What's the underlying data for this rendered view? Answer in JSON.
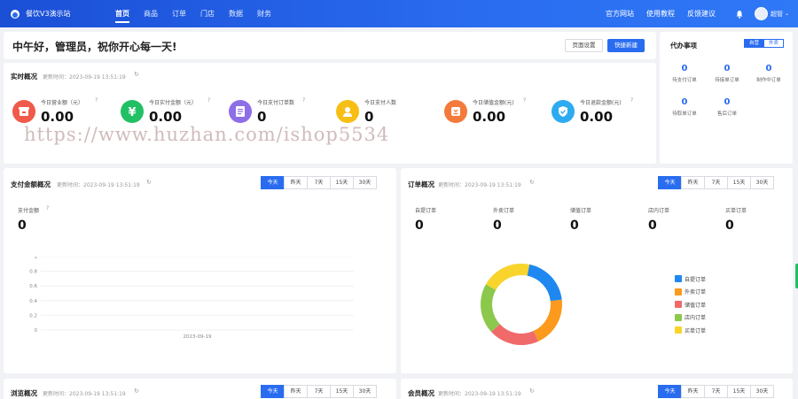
{
  "app": {
    "title": "餐饮V3演示站"
  },
  "nav": [
    {
      "label": "首页",
      "active": true
    },
    {
      "label": "商品",
      "active": false
    },
    {
      "label": "订单",
      "active": false
    },
    {
      "label": "门店",
      "active": false
    },
    {
      "label": "数据",
      "active": false
    },
    {
      "label": "财务",
      "active": false
    }
  ],
  "header_links": [
    "官方网站",
    "使用教程",
    "反馈建议"
  ],
  "user": {
    "name": "超管"
  },
  "greeting": {
    "text": "中午好，管理员，祝你开心每一天!",
    "settings_button": "页面设置",
    "quick_button": "快捷新建"
  },
  "realtime": {
    "title": "实时概况",
    "updated": "更新时间：2023-09-19 13:51:19",
    "metrics": [
      {
        "label": "今日营业额（元）",
        "value": "0.00",
        "color": "#f05a4a",
        "icon": "store-icon"
      },
      {
        "label": "今日实付金额（元）",
        "value": "0.00",
        "color": "#22c064",
        "icon": "yuan-icon"
      },
      {
        "label": "今日支付订单数",
        "value": "0",
        "color": "#8e6ee6",
        "icon": "list-icon"
      },
      {
        "label": "今日支付人数",
        "value": "0",
        "color": "#f7be14",
        "icon": "person-icon"
      },
      {
        "label": "今日储值金额(元)",
        "value": "0.00",
        "color": "#f47a3c",
        "icon": "wallet-icon"
      },
      {
        "label": "今日退款金额(元)",
        "value": "0.00",
        "color": "#2eaaf0",
        "icon": "shield-icon"
      }
    ]
  },
  "watermark": "https://www.huzhan.com/ishop5534",
  "todo": {
    "title": "代办事项",
    "toggle": [
      "自营",
      "外卖"
    ],
    "items": [
      {
        "num": "0",
        "label": "待支付订单"
      },
      {
        "num": "0",
        "label": "待接单订单"
      },
      {
        "num": "0",
        "label": "制作中订单"
      },
      {
        "num": "0",
        "label": "待取单订单"
      },
      {
        "num": "0",
        "label": "售后订单"
      }
    ]
  },
  "filters": [
    "今天",
    "昨天",
    "7天",
    "15天",
    "30天"
  ],
  "payment": {
    "title": "支付金额概况",
    "updated": "更新时间：2023-09-19 13:51:19",
    "metric_label": "支付金额",
    "metric_value": "0"
  },
  "orders": {
    "title": "订单概况",
    "updated": "更新时间：2023-09-19 13:51:19",
    "stats": [
      {
        "label": "自提订单",
        "value": "0"
      },
      {
        "label": "外卖订单",
        "value": "0"
      },
      {
        "label": "储值订单",
        "value": "0"
      },
      {
        "label": "店内订单",
        "value": "0"
      },
      {
        "label": "买单订单",
        "value": "0"
      }
    ]
  },
  "browse": {
    "title": "浏览概况",
    "updated": "更新时间：2023-09-19 13:51:19"
  },
  "member": {
    "title": "会员概况",
    "updated": "更新时间：2023-09-19 13:51:19"
  },
  "chart_data": [
    {
      "type": "line",
      "x": [
        "2023-09-19"
      ],
      "series": [
        {
          "values": [
            0
          ]
        }
      ],
      "yticks": [
        "1",
        "0.8",
        "0.6",
        "0.4",
        "0.2",
        "0"
      ],
      "ylim": [
        0,
        1
      ],
      "grid": true
    },
    {
      "type": "pie",
      "categories": [
        "自提订单",
        "外卖订单",
        "储值订单",
        "店内订单",
        "买单订单"
      ],
      "values": [
        20,
        20,
        20,
        20,
        20
      ],
      "colors": [
        "#1e88f0",
        "#fb9a1c",
        "#f06a6a",
        "#8cc84b",
        "#f8d42c"
      ],
      "legend": "right"
    }
  ]
}
